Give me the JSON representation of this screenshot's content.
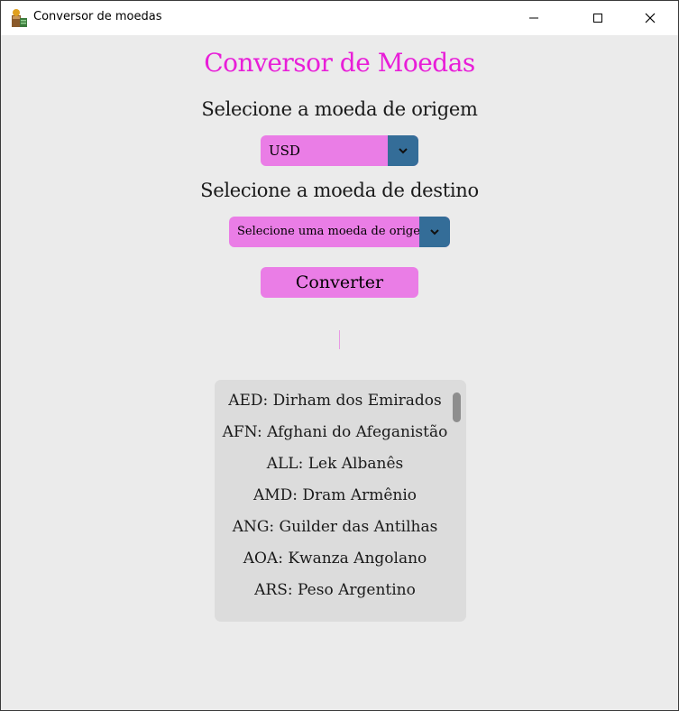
{
  "window": {
    "title": "Conversor de moedas"
  },
  "main": {
    "heading": "Conversor de Moedas",
    "origin_label": "Selecione a moeda de origem",
    "origin_select_value": "USD",
    "destination_label": "Selecione a moeda de destino",
    "destination_select_value": "Selecione uma moeda de origem",
    "convert_button": "Converter",
    "result_text": ""
  },
  "currency_list": [
    "AED: Dirham dos Emirados",
    "AFN: Afghani do Afeganistão",
    "ALL: Lek Albanês",
    "AMD: Dram Armênio",
    "ANG: Guilder das Antilhas",
    "AOA: Kwanza Angolano",
    "ARS: Peso Argentino"
  ],
  "colors": {
    "heading": "#e81ed8",
    "widget_background": "#ea7de6",
    "dropdown_arrow_background": "#346d98",
    "window_background": "#ebebeb",
    "list_background": "#dcdcdc"
  },
  "icons": {
    "app": "money-bag-icon",
    "minimize": "minimize-icon",
    "maximize": "maximize-icon",
    "close": "close-icon",
    "dropdown": "chevron-down-icon"
  }
}
